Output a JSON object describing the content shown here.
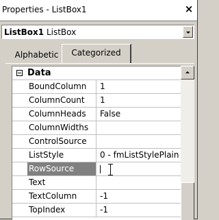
{
  "window": {
    "title": "Properties - ListBox1",
    "close_glyph": "×"
  },
  "object_selector": {
    "name": "ListBox1",
    "type": "ListBox"
  },
  "tabs": [
    {
      "label": "Alphabetic",
      "active": false
    },
    {
      "label": "Categorized",
      "active": true
    }
  ],
  "grid": {
    "category": "Data",
    "rows": [
      {
        "name": "BoundColumn",
        "value": "1"
      },
      {
        "name": "ColumnCount",
        "value": "1"
      },
      {
        "name": "ColumnHeads",
        "value": "False"
      },
      {
        "name": "ColumnWidths",
        "value": ""
      },
      {
        "name": "ControlSource",
        "value": ""
      },
      {
        "name": "ListStyle",
        "value": "0 - fmListStylePlain"
      },
      {
        "name": "RowSource",
        "value": "",
        "selected": true
      },
      {
        "name": "Text",
        "value": ""
      },
      {
        "name": "TextColumn",
        "value": "-1"
      },
      {
        "name": "TopIndex",
        "value": "-1"
      }
    ]
  },
  "colors": {
    "selected_row": "#808080",
    "face": "#d4d0c8"
  }
}
